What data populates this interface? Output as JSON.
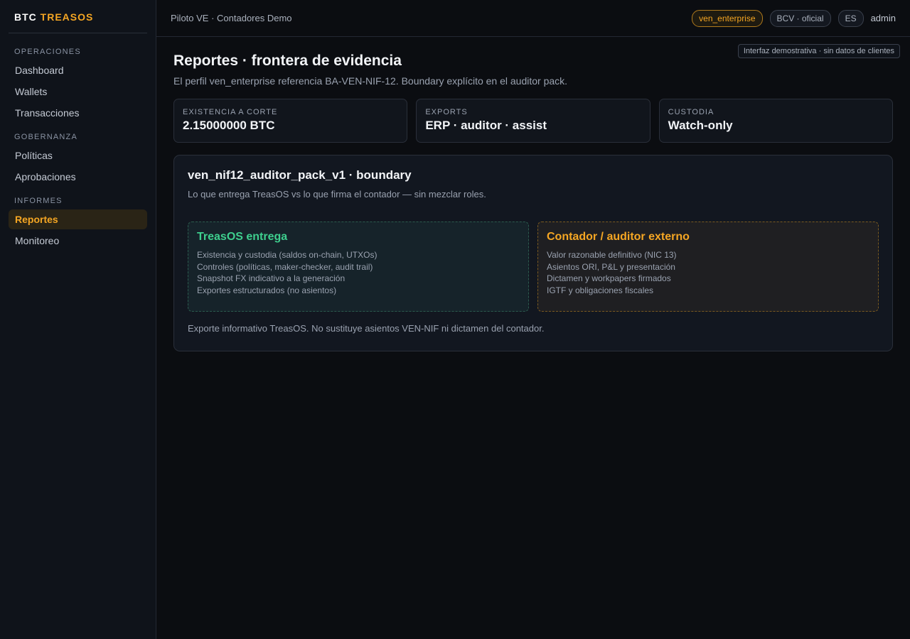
{
  "brand": {
    "prefix": "BTC",
    "name": "TREASOS"
  },
  "sidebar": {
    "sections": [
      {
        "label": "OPERACIONES",
        "items": [
          "Dashboard",
          "Wallets",
          "Transacciones"
        ]
      },
      {
        "label": "GOBERNANZA",
        "items": [
          "Políticas",
          "Aprobaciones"
        ]
      },
      {
        "label": "INFORMES",
        "items": [
          "Reportes",
          "Monitoreo"
        ]
      }
    ],
    "active": "Reportes"
  },
  "topbar": {
    "breadcrumb": "Piloto VE · Contadores Demo",
    "profile_pill": "ven_enterprise",
    "fx_pill": "BCV · oficial",
    "lang_pill": "ES",
    "user": "admin"
  },
  "demo_tag": "Interfaz demostrativa · sin datos de clientes",
  "page": {
    "title": "Reportes · frontera de evidencia",
    "subtitle": "El perfil ven_enterprise referencia BA-VEN-NIF-12. Boundary explícito en el auditor pack."
  },
  "stats": [
    {
      "label": "EXISTENCIA A CORTE",
      "value": "2.15000000 BTC"
    },
    {
      "label": "EXPORTS",
      "value": "ERP · auditor · assist"
    },
    {
      "label": "CUSTODIA",
      "value": "Watch-only"
    }
  ],
  "panel": {
    "title": "ven_nif12_auditor_pack_v1 · boundary",
    "subtitle": "Lo que entrega TreasOS vs lo que firma el contador — sin mezclar roles.",
    "treasos": {
      "title": "TreasOS entrega",
      "lines": [
        "Existencia y custodia (saldos on-chain, UTXOs)",
        "Controles (políticas, maker-checker, audit trail)",
        "Snapshot FX indicativo a la generación",
        "Exportes estructurados (no asientos)"
      ]
    },
    "auditor": {
      "title": "Contador / auditor externo",
      "lines": [
        "Valor razonable definitivo (NIC 13)",
        "Asientos ORI, P&L y presentación",
        "Dictamen y workpapers firmados",
        "IGTF y obligaciones fiscales"
      ]
    },
    "footnote": "Exporte informativo TreasOS. No sustituye asientos VEN-NIF ni dictamen del contador."
  },
  "colors": {
    "accent": "#f5a623",
    "green": "#3ecf8e",
    "bg": "#0b0d11"
  }
}
